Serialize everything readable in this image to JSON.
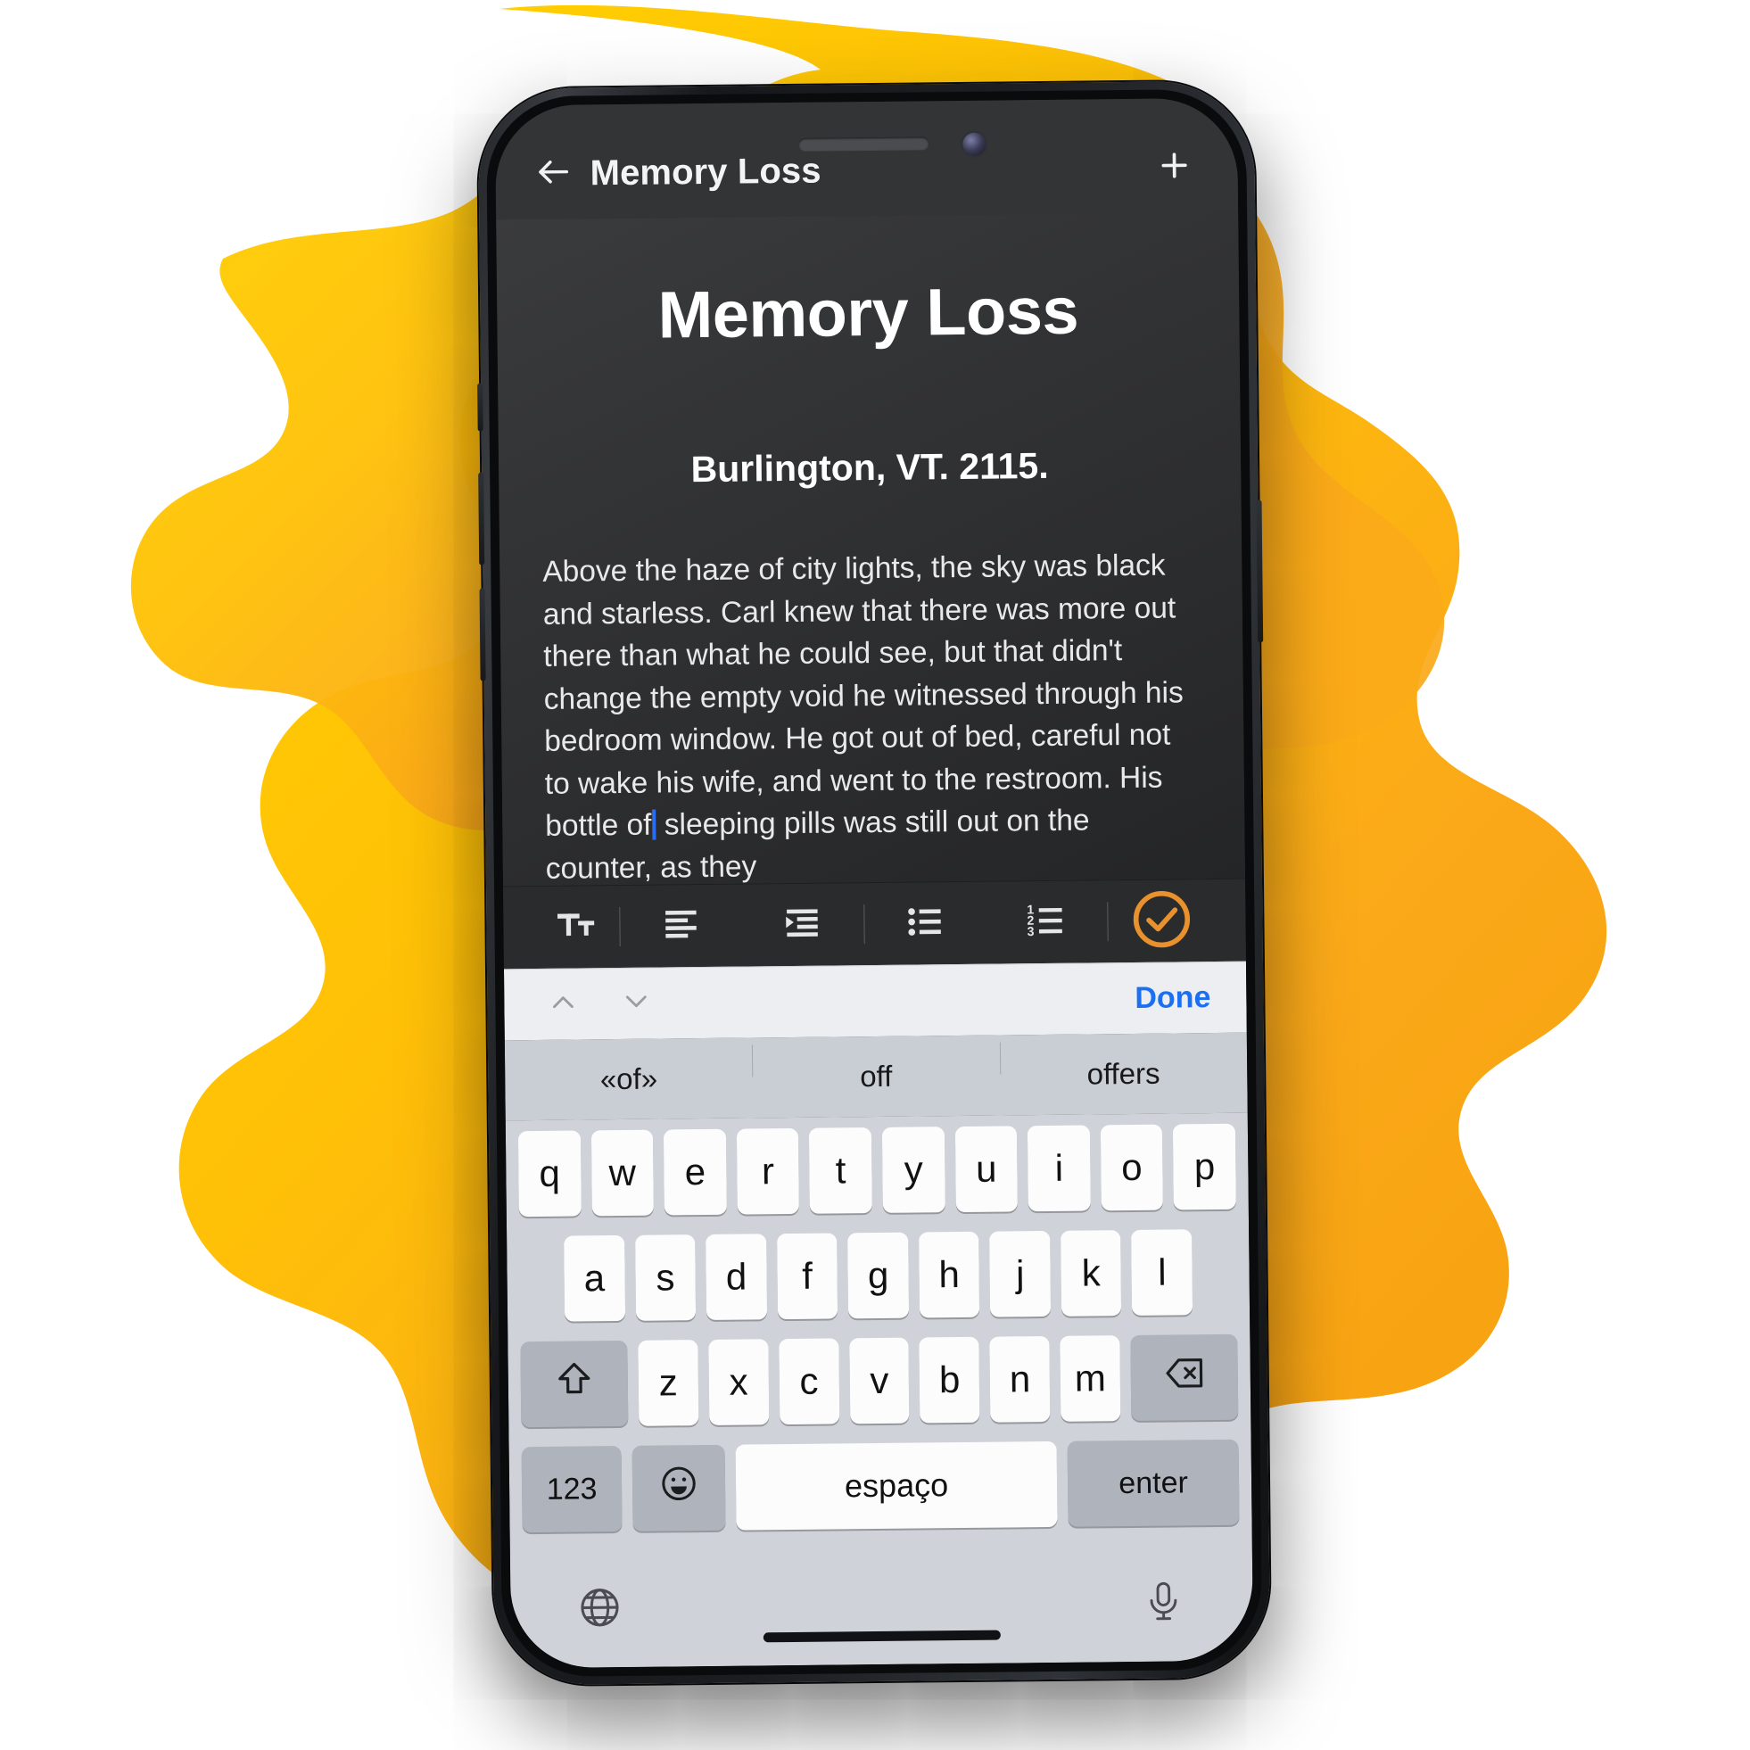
{
  "background": {
    "paint_colors": [
      "#FFD000",
      "#FBA919",
      "#F5A623"
    ]
  },
  "device": {
    "frame_color": "#1b1d20",
    "notch": {
      "speaker": "speaker-grille",
      "camera": "front-camera"
    }
  },
  "appbar": {
    "back_icon": "arrow-left-icon",
    "title": "Memory Loss",
    "add_icon": "plus-icon"
  },
  "note": {
    "title": "Memory Loss",
    "subtitle": "Burlington, VT. 2115.",
    "body": "Above the haze of city lights, the sky was black and starless. Carl knew that there was more out there than what he could see, but that didn't change the empty void he witnessed through his bedroom window. He got out of bed, careful not to wake his wife, and went to the restroom. His bottle of",
    "body_continued": "sleeping pills was still out on the counter, as they",
    "caret_color": "#2b6cf6",
    "text_color": "#e9e9e9",
    "background_color": "#2b2c2e"
  },
  "format_toolbar": {
    "background": "#2a2b2d",
    "items": [
      {
        "name": "text-format-icon",
        "label": "Tt"
      },
      {
        "name": "align-left-icon",
        "label": "Align left"
      },
      {
        "name": "indent-icon",
        "label": "Indent"
      },
      {
        "name": "bulleted-list-icon",
        "label": "Bulleted list"
      },
      {
        "name": "numbered-list-icon",
        "label": "Numbered list"
      }
    ],
    "confirm": {
      "name": "check-circle-icon",
      "color": "#E8912D",
      "label": "Done"
    }
  },
  "keyboard_accessory": {
    "prev_icon": "chevron-up-icon",
    "next_icon": "chevron-down-icon",
    "done_label": "Done",
    "done_color": "#1c6ff0",
    "background": "#eceef1"
  },
  "suggestions": {
    "background": "#c9cdd4",
    "items": [
      "«of»",
      "off",
      "offers"
    ]
  },
  "keyboard": {
    "language": "Portuguese",
    "background": "#cfd3d9",
    "key_color": "#fcfcfd",
    "modifier_key_color": "#aeb3bc",
    "row1": [
      "q",
      "w",
      "e",
      "r",
      "t",
      "y",
      "u",
      "i",
      "o",
      "p"
    ],
    "row2": [
      "a",
      "s",
      "d",
      "f",
      "g",
      "h",
      "j",
      "k",
      "l"
    ],
    "row3": [
      "z",
      "x",
      "c",
      "v",
      "b",
      "n",
      "m"
    ],
    "shift_icon": "shift-arrow-icon",
    "backspace_icon": "backspace-icon",
    "numbers_label": "123",
    "emoji_icon": "emoji-smiley-icon",
    "space_label": "espaço",
    "enter_label": "enter",
    "globe_icon": "globe-icon",
    "mic_icon": "microphone-icon"
  }
}
